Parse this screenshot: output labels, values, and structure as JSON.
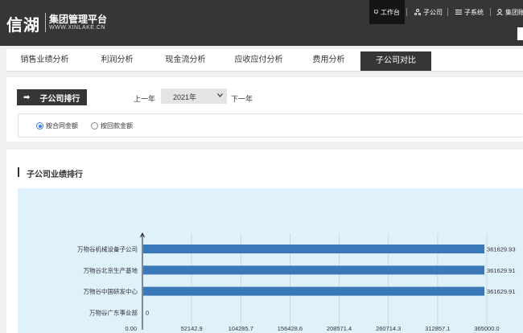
{
  "header": {
    "logo_main": "信湖",
    "logo_title": "集团管理平台",
    "logo_sub": "WWW.XINLAKE.CN",
    "nav": [
      {
        "label": "工作台",
        "icon": "monitor-icon"
      },
      {
        "label": "子公司",
        "icon": "org-icon"
      },
      {
        "label": "子系统",
        "icon": "list-icon"
      },
      {
        "label": "集团账",
        "icon": "user-icon"
      }
    ]
  },
  "tabs": [
    {
      "label": "销售业绩分析"
    },
    {
      "label": "利润分析"
    },
    {
      "label": "现金流分析"
    },
    {
      "label": "应收应付分析"
    },
    {
      "label": "费用分析"
    },
    {
      "label": "子公司对比"
    }
  ],
  "filters": {
    "rank_button": "子公司排行",
    "rank_arrow": "➡",
    "prev_year": "上一年",
    "year_value": "2021年",
    "next_year": "下一年",
    "radio_contract": "按合同金额",
    "radio_payment": "按回款金额"
  },
  "section_title": "子公司业绩排行",
  "chart_data": {
    "type": "bar",
    "orientation": "horizontal",
    "categories": [
      "万物谷机械设备子公司",
      "万物谷北京生产基地",
      "万物谷中国研发中心",
      "万物谷广东事业部"
    ],
    "values": [
      361629.93,
      361629.91,
      361629.91,
      0
    ],
    "data_labels": [
      "361629.93",
      "361629.91",
      "361629.91",
      "0"
    ],
    "x_ticks": [
      "0.00",
      "52142.9",
      "104285.7",
      "156428.6",
      "208571.4",
      "260714.3",
      "312857.1",
      "365000.0"
    ],
    "xlim": [
      0,
      365000
    ],
    "grid": true,
    "bar_color": "#3b78b8"
  }
}
